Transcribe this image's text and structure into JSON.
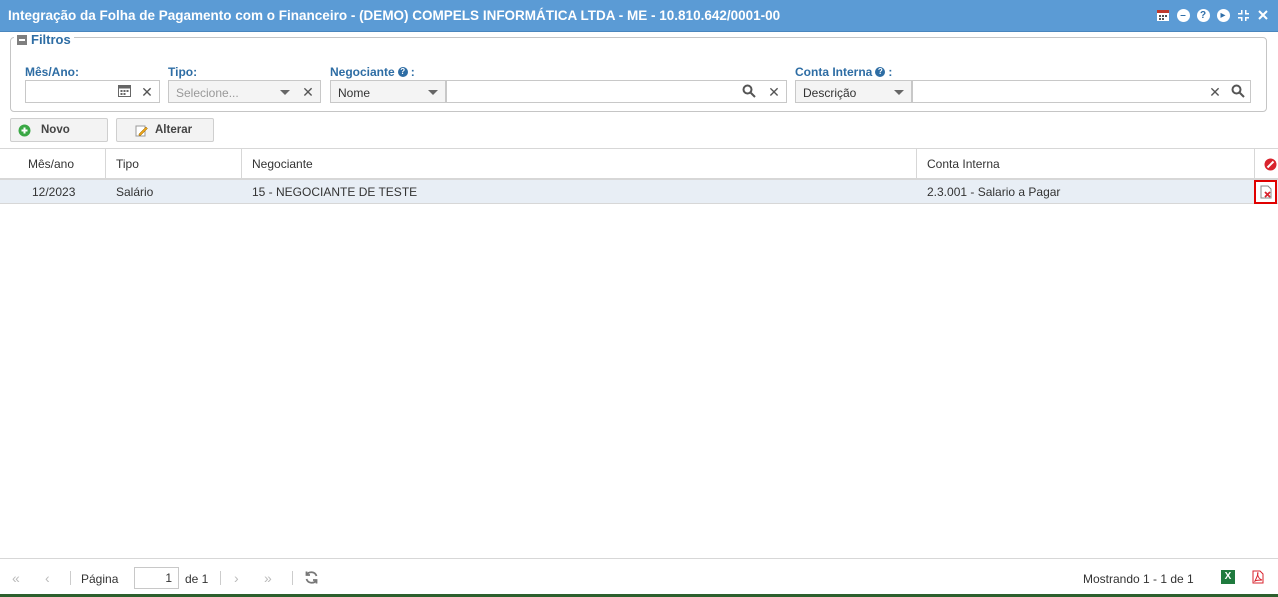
{
  "window": {
    "title": "Integração da Folha de Pagamento com o Financeiro - (DEMO) COMPELS INFORMÁTICA LTDA - ME - 10.810.642/0001-00",
    "tools": [
      "calendar-icon",
      "minimize-icon",
      "help-icon",
      "play-icon",
      "compress-icon",
      "close-icon"
    ]
  },
  "filters": {
    "legend": "Filtros",
    "mes_ano": {
      "label": "Mês/Ano:",
      "value": ""
    },
    "tipo": {
      "label": "Tipo:",
      "placeholder": "Selecione..."
    },
    "negociante": {
      "label": "Negociante",
      "select": "Nome",
      "value": ""
    },
    "conta_interna": {
      "label": "Conta Interna",
      "select": "Descrição",
      "value": ""
    }
  },
  "toolbar": {
    "novo": "Novo",
    "alterar": "Alterar"
  },
  "grid": {
    "columns": [
      "Mês/ano",
      "Tipo",
      "Negociante",
      "Conta Interna"
    ],
    "rows": [
      {
        "mes_ano": "12/2023",
        "tipo": "Salário",
        "negociante": "15 - NEGOCIANTE DE TESTE",
        "conta": "2.3.001 - Salario a Pagar"
      }
    ]
  },
  "footer": {
    "page_label": "Página",
    "page_value": "1",
    "of_label": "de 1",
    "showing": "Mostrando 1 - 1 de 1"
  },
  "colors": {
    "titlebar": "#5b9bd5",
    "label": "#2e6da4",
    "row_selected": "#e8eef5",
    "highlight": "#e00000"
  }
}
